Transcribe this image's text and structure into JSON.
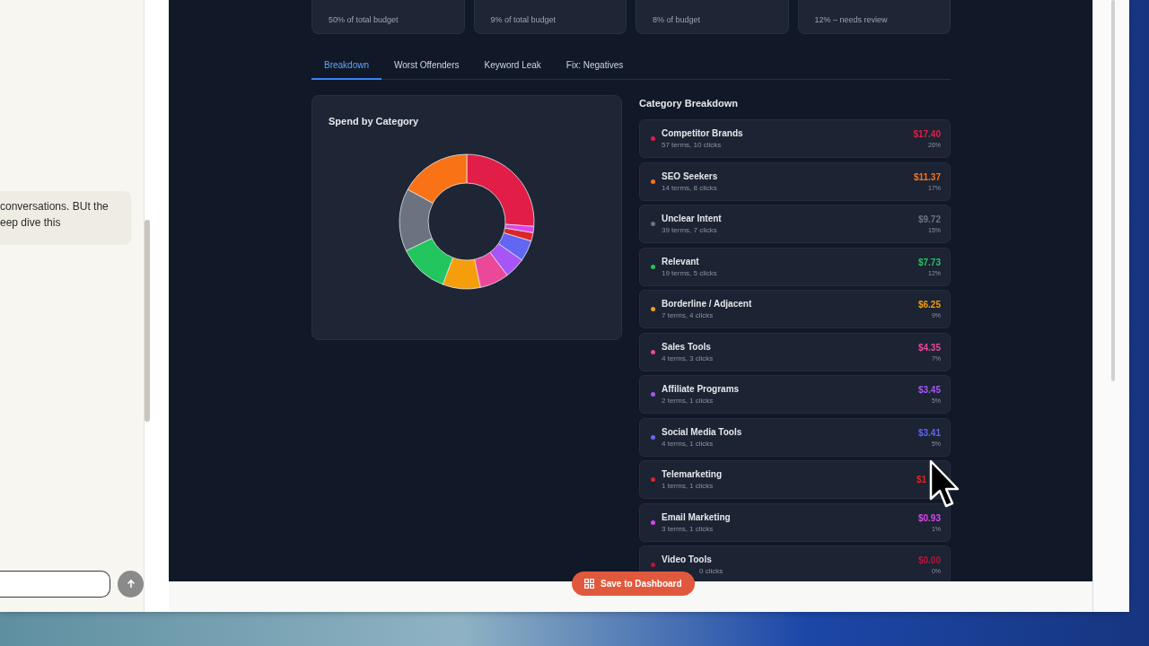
{
  "chat": {
    "bubble_lines": [
      "conversations. BUt the",
      "eep dive this"
    ]
  },
  "stat_cards": [
    {
      "caption": "50% of total budget"
    },
    {
      "caption": "9% of total budget"
    },
    {
      "caption": "8% of budget"
    },
    {
      "caption": "12% – needs review"
    }
  ],
  "tabs": [
    {
      "label": "Breakdown",
      "selected": true
    },
    {
      "label": "Worst Offenders",
      "selected": false
    },
    {
      "label": "Keyword Leak",
      "selected": false
    },
    {
      "label": "Fix: Negatives",
      "selected": false
    }
  ],
  "spend_panel": {
    "title": "Spend by Category"
  },
  "category_breakdown": {
    "title": "Category Breakdown",
    "items": [
      {
        "name": "Competitor Brands",
        "detail": "57 terms, 10 clicks",
        "amount": "$17.40",
        "share": "26%",
        "color": "#e11d48"
      },
      {
        "name": "SEO Seekers",
        "detail": "14 terms, 8 clicks",
        "amount": "$11.37",
        "share": "17%",
        "color": "#f97316"
      },
      {
        "name": "Unclear Intent",
        "detail": "39 terms, 7 clicks",
        "amount": "$9.72",
        "share": "15%",
        "color": "#6b7280"
      },
      {
        "name": "Relevant",
        "detail": "19 terms, 5 clicks",
        "amount": "$7.73",
        "share": "12%",
        "color": "#22c55e"
      },
      {
        "name": "Borderline / Adjacent",
        "detail": "7 terms, 4 clicks",
        "amount": "$6.25",
        "share": "9%",
        "color": "#f59e0b"
      },
      {
        "name": "Sales Tools",
        "detail": "4 terms, 3 clicks",
        "amount": "$4.35",
        "share": "7%",
        "color": "#ec4899"
      },
      {
        "name": "Affiliate Programs",
        "detail": "2 terms, 1 clicks",
        "amount": "$3.45",
        "share": "5%",
        "color": "#a855f7"
      },
      {
        "name": "Social Media Tools",
        "detail": "4 terms, 1 clicks",
        "amount": "$3.41",
        "share": "5%",
        "color": "#6366f1"
      },
      {
        "name": "Telemarketing",
        "detail": "1 terms, 1 clicks",
        "amount": "$1",
        "amount_covered": true,
        "color": "#dc2626"
      },
      {
        "name": "Email Marketing",
        "detail": "3 terms, 1 clicks",
        "amount": "$0.93",
        "share": "1%",
        "color": "#d946ef"
      },
      {
        "name": "Video Tools",
        "detail": "0 clicks",
        "detail_covered": true,
        "amount": "$0.00",
        "share": "0%",
        "color": "#be123c"
      }
    ]
  },
  "save_button": {
    "label": "Save to Dashboard"
  }
}
